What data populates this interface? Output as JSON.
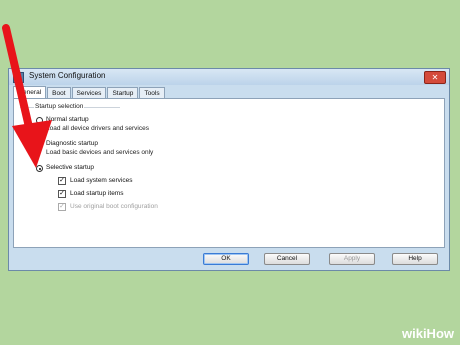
{
  "window": {
    "title": "System Configuration",
    "close_label": "✕"
  },
  "tabs": [
    "General",
    "Boot",
    "Services",
    "Startup",
    "Tools"
  ],
  "startup_selection": {
    "legend": "Startup selection",
    "normal": {
      "label": "Normal startup",
      "desc": "Load all device drivers and services"
    },
    "diagnostic": {
      "label": "Diagnostic startup",
      "desc": "Load basic devices and services only"
    },
    "selective": {
      "label": "Selective startup",
      "selected": true
    },
    "load_system_services": {
      "label": "Load system services",
      "checked": true
    },
    "load_startup_items": {
      "label": "Load startup items",
      "checked": true
    },
    "use_original_boot": {
      "label": "Use original boot configuration",
      "checked": true,
      "disabled": true
    }
  },
  "buttons": {
    "ok": "OK",
    "cancel": "Cancel",
    "apply": "Apply",
    "help": "Help"
  },
  "watermark": "wikiHow",
  "colors": {
    "arrow": "#e8141a",
    "background": "#b3d69e"
  }
}
